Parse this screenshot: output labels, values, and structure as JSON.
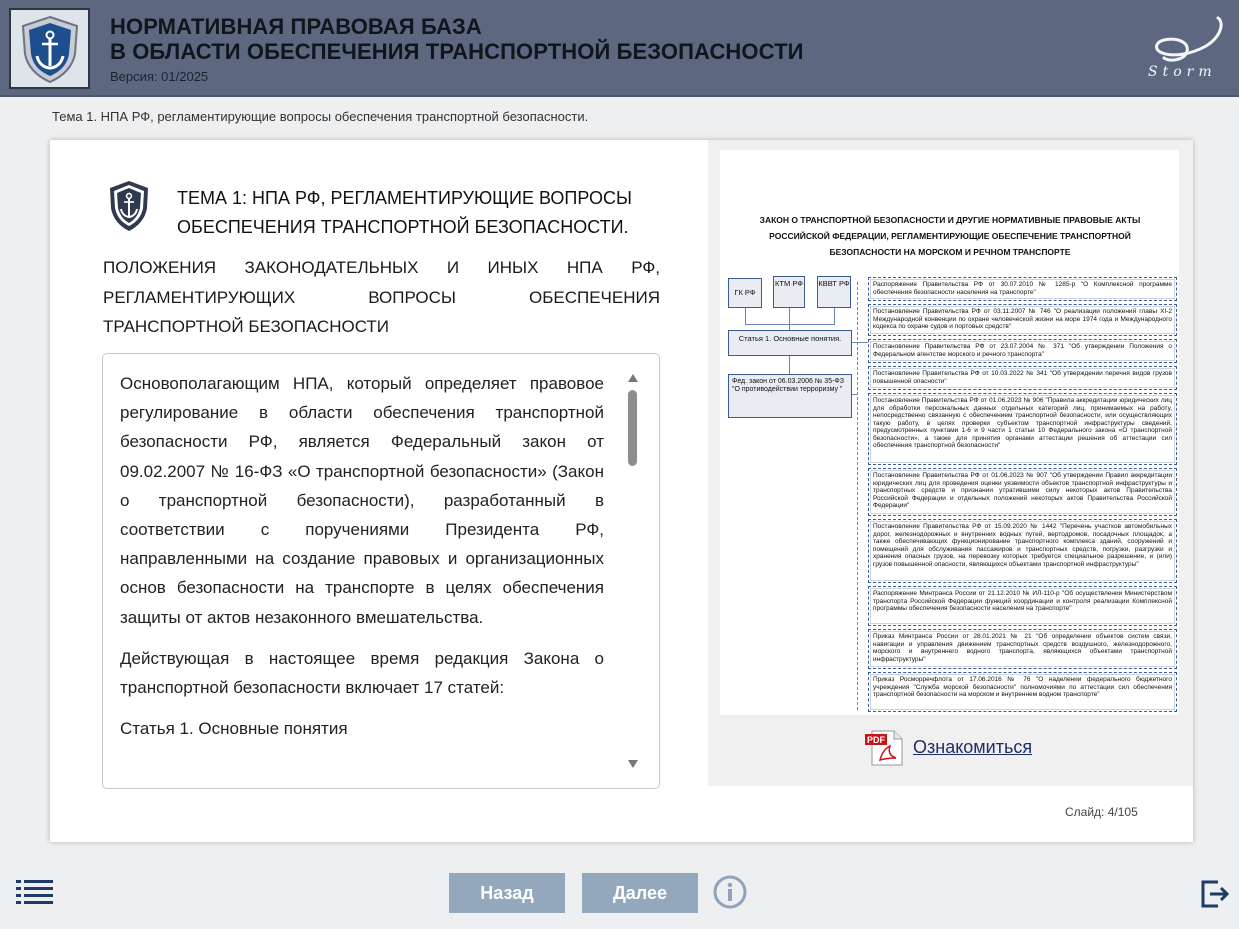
{
  "header": {
    "title_line1": "НОРМАТИВНАЯ ПРАВОВАЯ БАЗА",
    "title_line2": "В ОБЛАСТИ ОБЕСПЕЧЕНИЯ ТРАНСПОРТНОЙ БЕЗОПАСНОСТИ",
    "version": "Версия: 01/2025",
    "brand": "Storm"
  },
  "topic_breadcrumb": "Тема 1. НПА РФ, регламентирующие вопросы обеспечения транспортной безопасности.",
  "card": {
    "title_line1": "ТЕМА 1: НПА РФ, РЕГЛАМЕНТИРУЮЩИЕ ВОПРОСЫ",
    "title_line2": "ОБЕСПЕЧЕНИЯ ТРАНСПОРТНОЙ БЕЗОПАСНОСТИ.",
    "subtitle": "ПОЛОЖЕНИЯ ЗАКОНОДАТЕЛЬНЫХ И ИНЫХ НПА РФ, РЕГЛАМЕНТИРУЮЩИХ ВОПРОСЫ ОБЕСПЕЧЕНИЯ ТРАНСПОРТНОЙ БЕЗОПАСНОСТИ",
    "paragraphs": [
      "Основополагающим НПА, который определяет правовое регулирование в области обеспечения транспортной безопасности РФ, является Федеральный закон от 09.02.2007 № 16-ФЗ «О транспортной безопасности» (Закон о транспортной безопасности), разработанный в соответствии с поручениями Президента РФ, направленными на создание правовых и организационных основ безопасности на транспорте в целях обеспечения защиты от актов незаконного вмешательства.",
      "Действующая в настоящее время редакция Закона о транспортной безопасности включает 17 статей:",
      "Статья 1. Основные понятия"
    ]
  },
  "document": {
    "title": "ЗАКОН О ТРАНСПОРТНОЙ БЕЗОПАСНОСТИ И ДРУГИЕ НОРМАТИВНЫЕ ПРАВОВЫЕ АКТЫ РОССИЙСКОЙ ФЕДЕРАЦИИ, РЕГЛАМЕНТИРУЮЩИЕ ОБЕСПЕЧЕНИЕ ТРАНСПОРТНОЙ БЕЗОПАСНОСТИ НА МОРСКОМ И РЕЧНОМ ТРАНСПОРТЕ",
    "left_boxes": {
      "gk": "ГК РФ",
      "ktm": "КТМ РФ",
      "kvvt": "КВВТ РФ",
      "article": "Статья 1. Основные понятия.",
      "fed_law": "Фед. закон от 06.03.2006 № 35-ФЗ \"О противодействии терроризму \""
    },
    "acts": [
      "Распоряжение Правительства РФ от 30.07.2010 № 1285-р \"О Комплексной программе обеспечения безопасности населения на транспорте\"",
      "Постановление Правительства РФ от 03.11.2007 № 746 \"О реализации положений главы XI-2 Международной конвенции по охране человеческой жизни на море 1974 года и Международного кодекса по охране судов и портовых средств\"",
      "Постановление Правительства РФ от 23.07.2004 № 371 \"Об утверждении Положения о Федеральном агентстве морского и речного транспорта\"",
      "Постановление Правительства РФ от 10.03.2022 № 341 \"Об утверждении перечня видов грузов повышенной опасности\"",
      "Постановление Правительства РФ от 01.06.2023 № 906 \"Правила аккредитации юридических лиц для обработки персональных данных отдельных категорий лиц, принимаемых на работу, непосредственно связанную с обеспечением транспортной безопасности, или осуществляющих такую работу, в целях проверки субъектом транспортной инфраструктуры сведений, предусмотренных пунктами 1-6 и 9 части 1 статьи 10 Федерального закона «О транспортной безопасности», а также для принятия органами аттестации решения об аттестации сил обеспечения транспортной безопасности\"",
      "Постановление Правительства РФ от 01.06.2023 № 907 \"Об утверждении Правил аккредитации юридических лиц для проведения оценки уязвимости объектов транспортной инфраструктуры и транспортных средств и признании утратившими силу некоторых актов Правительства Российской Федерации и отдельных положений некоторых актов Правительства Российской Федерации\"",
      "Постановление Правительства РФ от 15.09.2020 № 1442 \"Перечень участков автомобильных дорог, железнодорожных и внутренних водных путей, вертодромов, посадочных площадок, а также обеспечивающих функционирование транспортного комплекса зданий, сооружений и помещений для обслуживания пассажиров и транспортных средств, погрузки, разгрузки и хранения опасных грузов, на перевозку которых требуется специальное разрешение, и (или) грузов повышенной опасности, являющихся объектами транспортной инфраструктуры\"",
      "Распоряжение Минтранса России от 21.12.2010 № ИЛ-110-р \"Об осуществлении Министерством транспорта Российской Федерации функций координации и контроля реализации Комплексной программы обеспечения безопасности населения на транспорте\"",
      "Приказ Минтранса России от 28.01.2021 № 21 \"Об определении объектов систем связи, навигации и управления движением транспортных средств воздушного, железнодорожного, морского и внутреннего водного транспорта, являющихся объектами транспортной инфраструктуры\"",
      "Приказ Росморречфлота от 17.06.2016 № 76 \"О наделении федерального бюджетного учреждения \"Служба морской безопасности\" полномочиями по аттестации сил обеспечения транспортной безопасности на морском и внутреннем водном транспорте\""
    ],
    "link_label": "Ознакомиться",
    "pdf_caption": "PDF"
  },
  "slide": {
    "label": "Слайд:  4/105"
  },
  "nav": {
    "back": "Назад",
    "next": "Далее"
  },
  "colors": {
    "header_bg": "#5d6880",
    "button_bg": "#93a7bd",
    "link": "#1d2f6a"
  }
}
